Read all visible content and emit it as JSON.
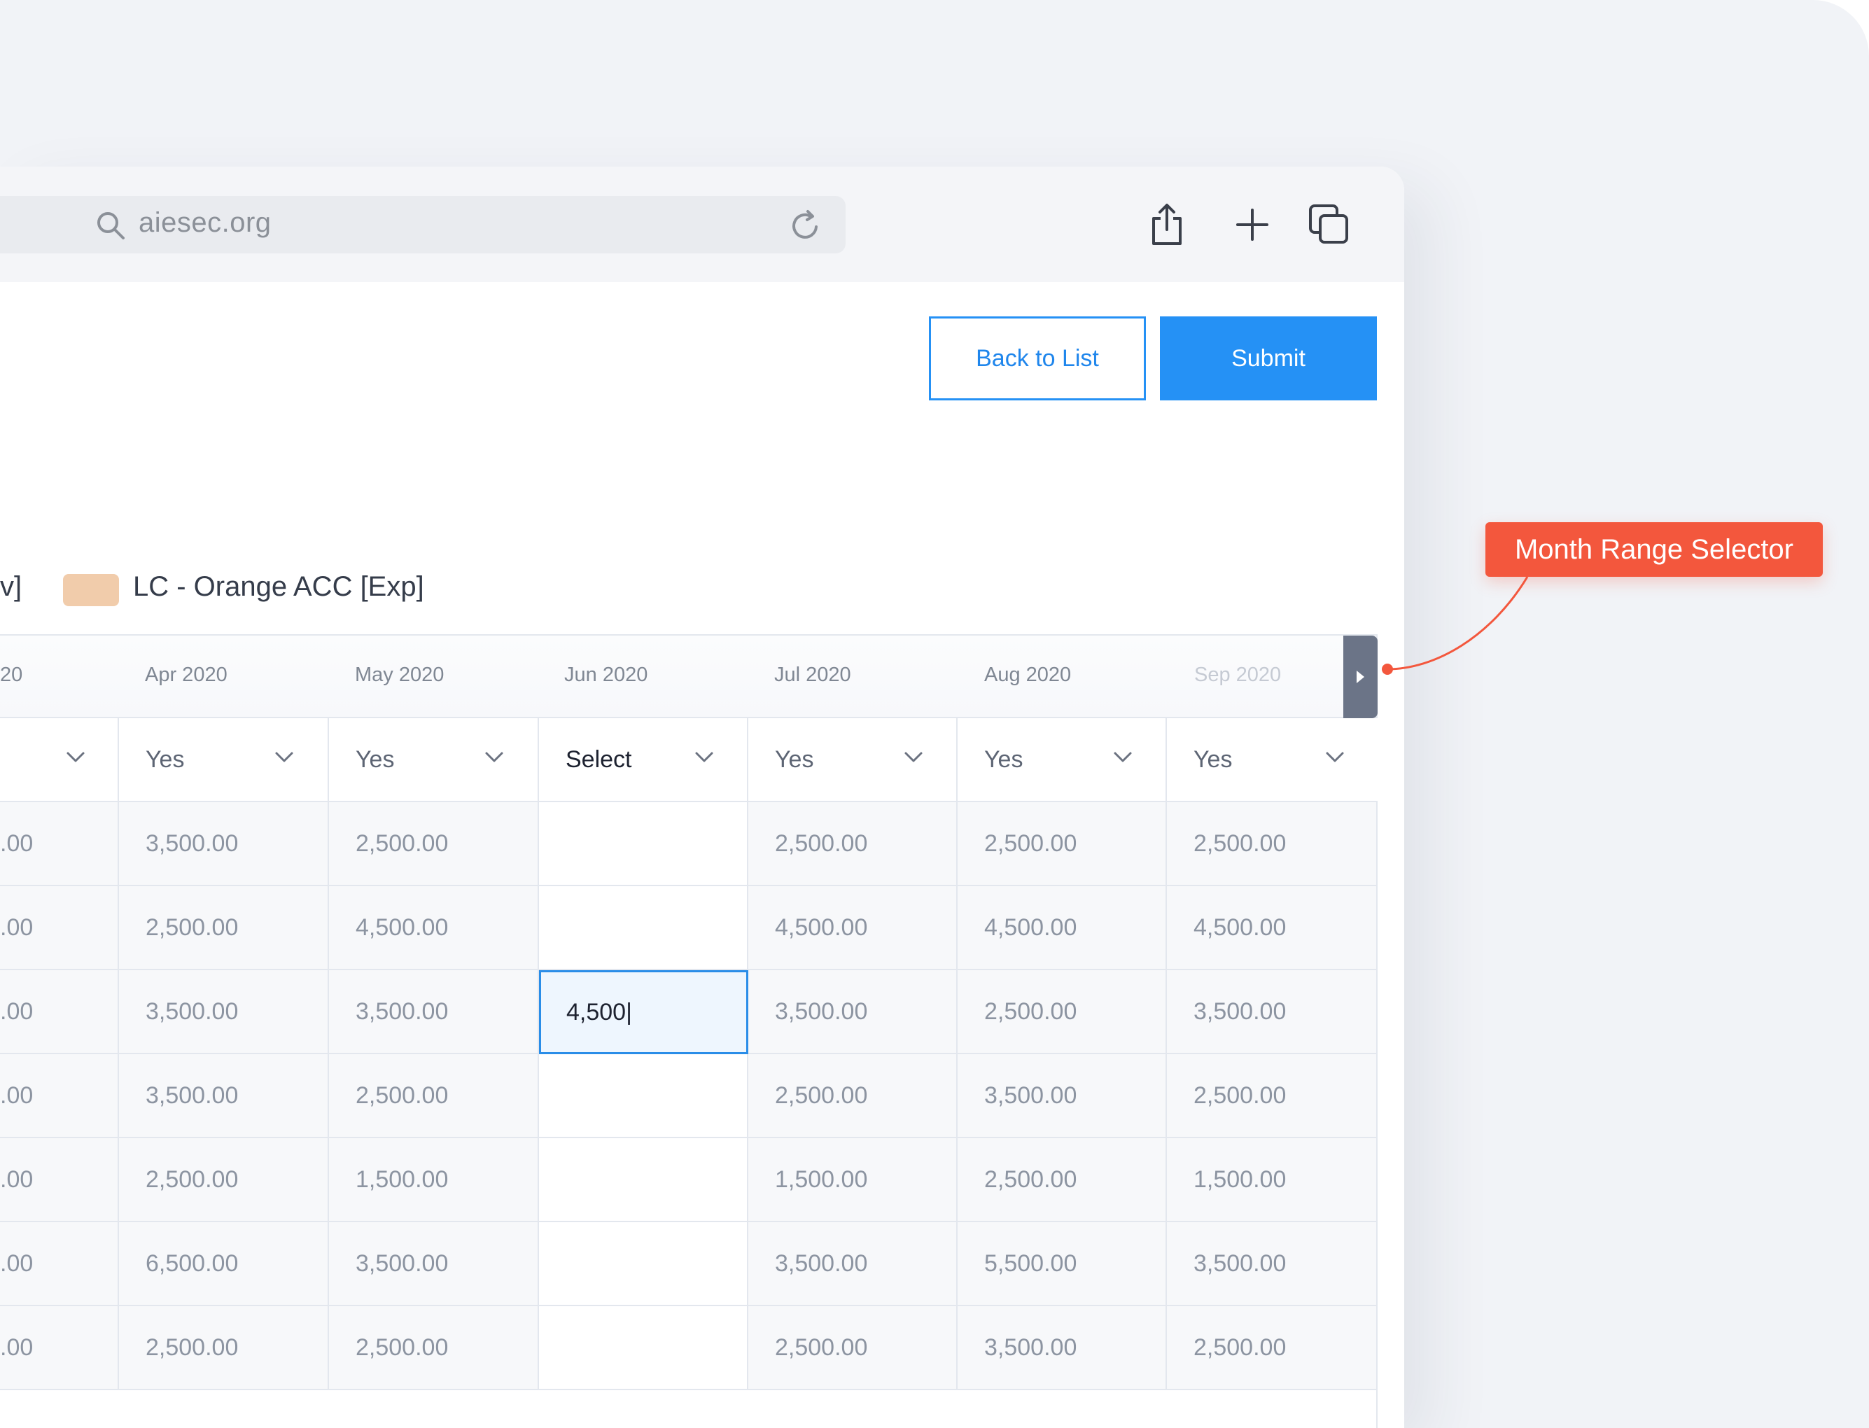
{
  "browser": {
    "url": "aiesec.org",
    "icons": [
      "search-icon",
      "reload-icon",
      "share-icon",
      "new-tab-icon",
      "tabs-icon"
    ]
  },
  "actions": {
    "back_label": "Back to List",
    "submit_label": "Submit"
  },
  "legend": {
    "partial_label": "v]",
    "item_label": "LC - Orange ACC [Exp]",
    "item_color": "#f1ccab"
  },
  "months": [
    "20",
    "Apr 2020",
    "May 2020",
    "Jun 2020",
    "Jul 2020",
    "Aug 2020",
    "Sep 2020"
  ],
  "selects": [
    "",
    "Yes",
    "Yes",
    "Select",
    "Yes",
    "Yes",
    "Yes"
  ],
  "rows": [
    [
      ".00",
      "3,500.00",
      "2,500.00",
      "",
      "2,500.00",
      "2,500.00",
      "2,500.00"
    ],
    [
      ".00",
      "2,500.00",
      "4,500.00",
      "",
      "4,500.00",
      "4,500.00",
      "4,500.00"
    ],
    [
      ".00",
      "3,500.00",
      "3,500.00",
      "4,500|",
      "3,500.00",
      "2,500.00",
      "3,500.00"
    ],
    [
      ".00",
      "3,500.00",
      "2,500.00",
      "",
      "2,500.00",
      "3,500.00",
      "2,500.00"
    ],
    [
      ".00",
      "2,500.00",
      "1,500.00",
      "",
      "1,500.00",
      "2,500.00",
      "1,500.00"
    ],
    [
      ".00",
      "6,500.00",
      "3,500.00",
      "",
      "3,500.00",
      "5,500.00",
      "3,500.00"
    ],
    [
      ".00",
      "2,500.00",
      "2,500.00",
      "",
      "2,500.00",
      "3,500.00",
      "2,500.00"
    ]
  ],
  "annotation": {
    "label": "Month Range Selector",
    "color": "#f3573d"
  }
}
